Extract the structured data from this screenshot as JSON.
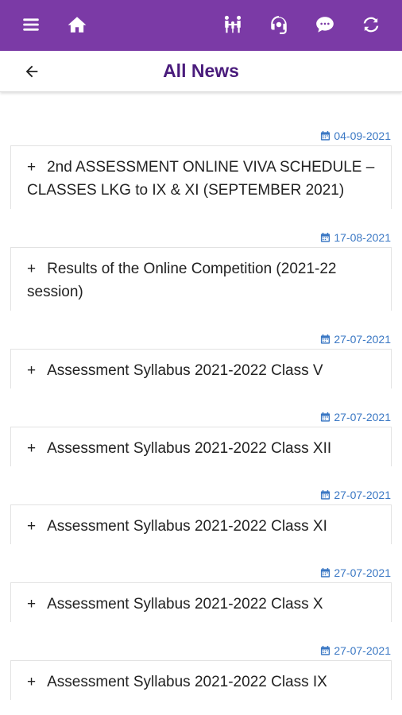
{
  "header": {
    "icons": [
      "menu-icon",
      "home-icon",
      "family-icon",
      "support-icon",
      "chat-icon",
      "refresh-icon"
    ],
    "accent_color": "#7b3aa6"
  },
  "titlebar": {
    "title": "All News"
  },
  "news": [
    {
      "date": "04-09-2021",
      "title": "2nd ASSESSMENT ONLINE VIVA SCHEDULE – CLASSES LKG to IX & XI (SEPTEMBER 2021)"
    },
    {
      "date": "17-08-2021",
      "title": "Results of the Online Competition (2021-22 session)"
    },
    {
      "date": "27-07-2021",
      "title": "Assessment Syllabus 2021-2022 Class V"
    },
    {
      "date": "27-07-2021",
      "title": "Assessment Syllabus 2021-2022 Class XII"
    },
    {
      "date": "27-07-2021",
      "title": "Assessment Syllabus 2021-2022 Class XI"
    },
    {
      "date": "27-07-2021",
      "title": "Assessment Syllabus 2021-2022 Class X"
    },
    {
      "date": "27-07-2021",
      "title": "Assessment Syllabus 2021-2022 Class IX"
    }
  ],
  "expand_symbol": "+"
}
